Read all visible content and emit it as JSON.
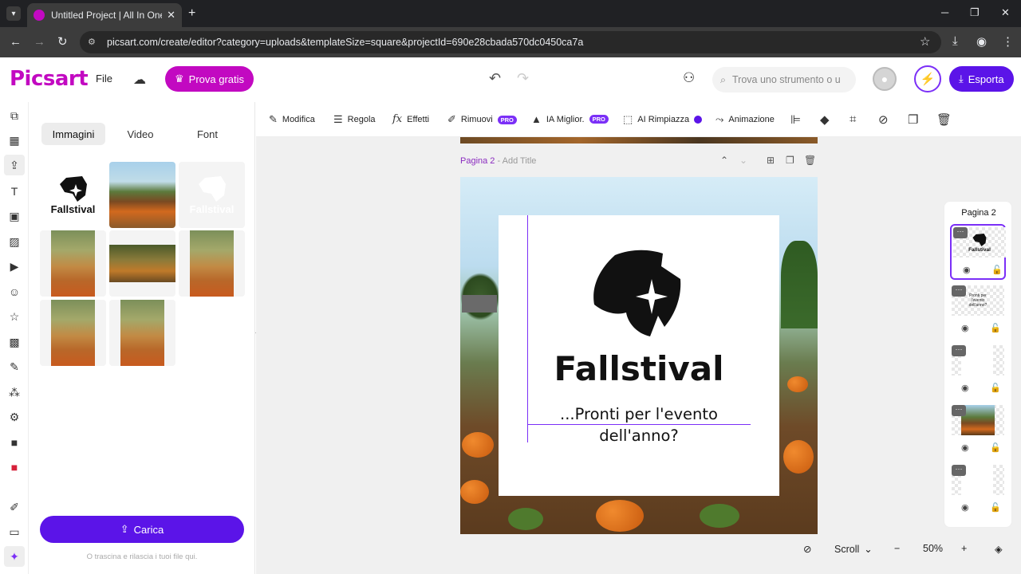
{
  "browser": {
    "tab_title": "Untitled Project | All In One We",
    "url": "picsart.com/create/editor?category=uploads&templateSize=square&projectId=690e28cbada570dc0450ca7a"
  },
  "header": {
    "logo": "Picsart",
    "file": "File",
    "prova": "Prova gratis",
    "search_placeholder": "Trova uno strumento o u",
    "esporta": "Esporta"
  },
  "panel": {
    "tabs": [
      "Immagini",
      "Video",
      "Font"
    ],
    "logo_text": "Fallstival",
    "carica": "Carica",
    "drop_hint": "O trascina e rilascia i tuoi file qui."
  },
  "toolbar": {
    "modifica": "Modifica",
    "regola": "Regola",
    "effetti": "Effetti",
    "rimuovi": "Rimuovi",
    "ia_miglior": "IA Miglior.",
    "ai_rimpiazza": "AI Rimpiazza",
    "animazione": "Animazione",
    "pro": "PRO"
  },
  "canvas": {
    "page_label": "Pagina 2",
    "add_title": "Add Title",
    "title": "Fallstival",
    "subtitle": "...Pronti per l'evento dell'anno?",
    "scroll": "Scroll",
    "zoom": "50%"
  },
  "pages": {
    "title": "Pagina 2",
    "thumb1_text": "Fallstival",
    "thumb2_text": "Pronti per l'evento dell'anno?"
  },
  "colors": {
    "brand": "#c209c1",
    "accent": "#5b14e8"
  }
}
